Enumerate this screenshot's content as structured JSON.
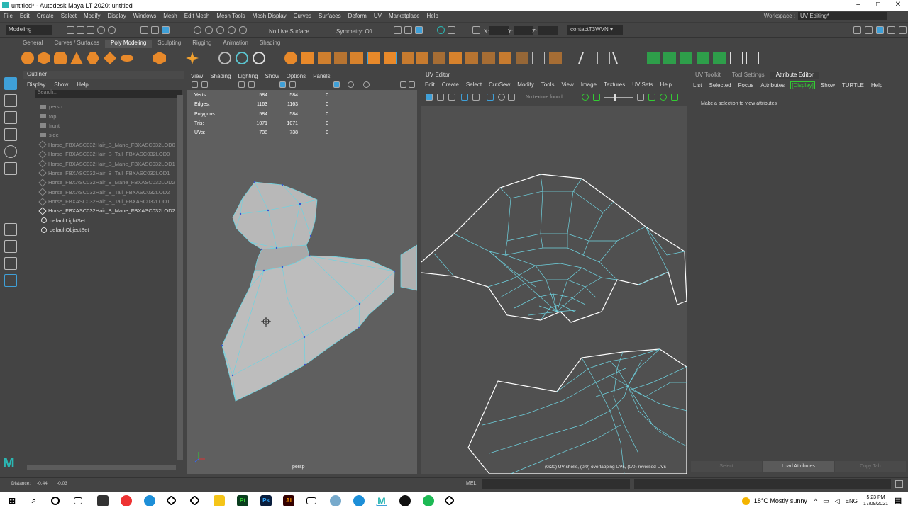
{
  "window": {
    "title": "untitled* - Autodesk Maya LT 2020: untitled",
    "min": "–",
    "max": "☐",
    "close": "✕"
  },
  "menubar": [
    "File",
    "Edit",
    "Create",
    "Select",
    "Modify",
    "Display",
    "Windows",
    "Mesh",
    "Edit Mesh",
    "Mesh Tools",
    "Mesh Display",
    "Curves",
    "Surfaces",
    "Deform",
    "UV",
    "Marketplace",
    "Help"
  ],
  "workspace": {
    "label": "Workspace :",
    "value": "UV Editing*"
  },
  "statusline": {
    "mode": "Modeling",
    "live_surface": "No Live Surface",
    "symmetry": "Symmetry: Off",
    "x_label": "X:",
    "y_label": "Y:",
    "z_label": "Z:",
    "user": "contactT3WVN"
  },
  "shelf_tabs": [
    "General",
    "Curves / Surfaces",
    "Poly Modeling",
    "Sculpting",
    "Rigging",
    "Animation",
    "Shading"
  ],
  "outliner": {
    "title": "Outliner",
    "menu": [
      "Display",
      "Show",
      "Help"
    ],
    "search_placeholder": "Search...",
    "items": [
      {
        "label": "persp",
        "style": "dim"
      },
      {
        "label": "top",
        "style": "dim"
      },
      {
        "label": "front",
        "style": "dim"
      },
      {
        "label": "side",
        "style": "dim"
      },
      {
        "label": "Horse_FBXASC032Hair_B_Mane_FBXASC032LOD0",
        "style": "dim"
      },
      {
        "label": "Horse_FBXASC032Hair_B_Tail_FBXASC032LOD0",
        "style": "dim"
      },
      {
        "label": "Horse_FBXASC032Hair_B_Mane_FBXASC032LOD1",
        "style": "dim"
      },
      {
        "label": "Horse_FBXASC032Hair_B_Tail_FBXASC032LOD1",
        "style": "dim"
      },
      {
        "label": "Horse_FBXASC032Hair_B_Mane_FBXASC032LOD2",
        "style": "dim"
      },
      {
        "label": "Horse_FBXASC032Hair_B_Tail_FBXASC032LOD2",
        "style": "dim"
      },
      {
        "label": "Horse_FBXASC032Hair_B_Tail_FBXASC032LOD1",
        "style": "dim"
      },
      {
        "label": "Horse_FBXASC032Hair_B_Mane_FBXASC032LOD2",
        "style": "bright"
      },
      {
        "label": "defaultLightSet",
        "style": "bright"
      },
      {
        "label": "defaultObjectSet",
        "style": "bright"
      }
    ]
  },
  "viewport": {
    "menu": [
      "View",
      "Shading",
      "Lighting",
      "Show",
      "Options",
      "Panels"
    ],
    "hud": [
      {
        "label": "Verts:",
        "a": "584",
        "b": "584",
        "c": "0"
      },
      {
        "label": "Edges:",
        "a": "1163",
        "b": "1163",
        "c": "0"
      },
      {
        "label": "Polygons:",
        "a": "584",
        "b": "584",
        "c": "0"
      },
      {
        "label": "Tris:",
        "a": "1071",
        "b": "1071",
        "c": "0"
      },
      {
        "label": "UVs:",
        "a": "738",
        "b": "738",
        "c": "0"
      }
    ],
    "camera": "persp"
  },
  "uv_editor": {
    "title": "UV Editor",
    "menu": [
      "Edit",
      "Create",
      "Select",
      "Cut/Sew",
      "Modify",
      "Tools",
      "View",
      "Image",
      "Textures",
      "UV Sets",
      "Help"
    ],
    "texture": "No texture found",
    "status": "(0/20) UV shells, (0/0) overlapping UVs, (0/0) reversed UVs"
  },
  "attribute_editor": {
    "tabs": [
      "UV Toolkit",
      "Tool Settings",
      "Attribute Editor"
    ],
    "menu": [
      "List",
      "Selected",
      "Focus",
      "Attributes",
      "Show",
      "TURTLE",
      "Help"
    ],
    "display_tag": "[Display]",
    "message": "Make a selection to view attributes",
    "buttons": [
      "Select",
      "Load Attributes",
      "Copy Tab"
    ]
  },
  "helpline": {
    "distance_label": "Distance:",
    "distance_a": "-0.44",
    "distance_b": "-0.03",
    "mel": "MEL"
  },
  "taskbar": {
    "weather": "18°C  Mostly sunny",
    "lang": "ENG",
    "time": "5:23 PM",
    "date": "17/09/2021"
  },
  "colors": {
    "wire": "#6fd3e0",
    "mesh": "#bdbdbd",
    "uvline": "#ffffff",
    "accent": "#3fa0d8"
  }
}
